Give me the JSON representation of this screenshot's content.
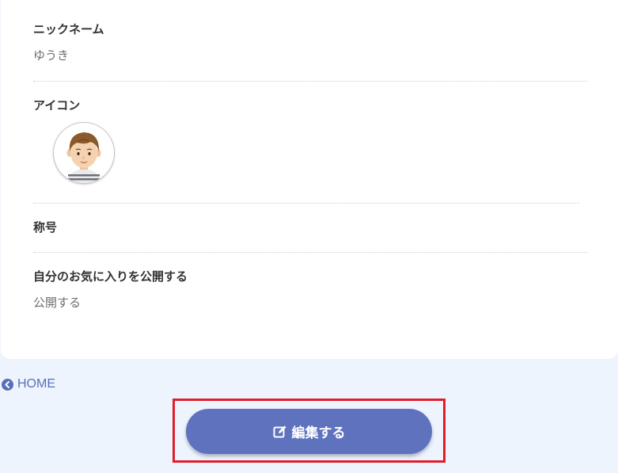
{
  "profile": {
    "nickname_label": "ニックネーム",
    "nickname_value": "ゆうき",
    "icon_label": "アイコン",
    "title_label": "称号",
    "title_value": "",
    "favorites_public_label": "自分のお気に入りを公開する",
    "favorites_public_value": "公開する"
  },
  "nav": {
    "home_label": "HOME",
    "home_icon": "chevron-circle-left-icon"
  },
  "actions": {
    "edit_label": "編集する",
    "edit_icon": "edit-icon"
  },
  "colors": {
    "accent": "#5e72bd",
    "link": "#5a6fb8",
    "highlight": "#e01e2a",
    "page_background": "#eef4fd"
  }
}
